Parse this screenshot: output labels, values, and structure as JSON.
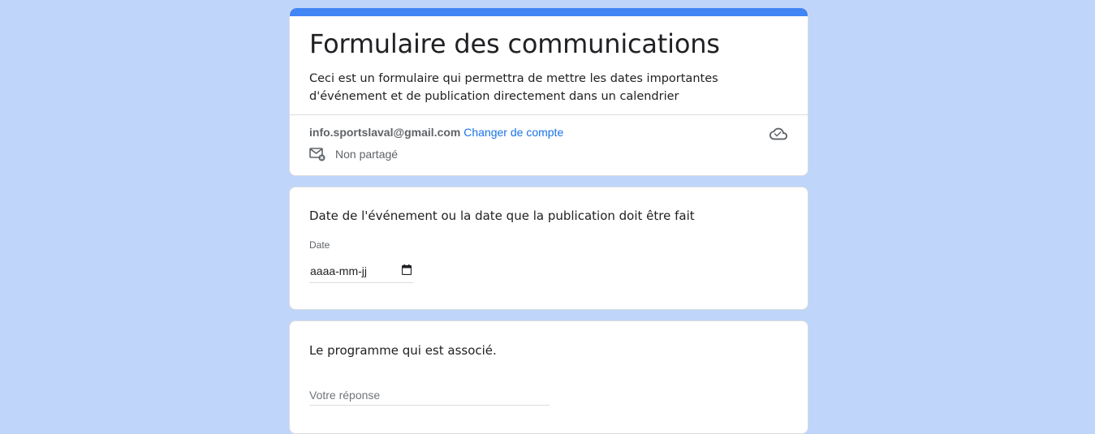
{
  "form": {
    "title": "Formulaire des communications",
    "description": "Ceci est un formulaire qui permettra de mettre les dates importantes d'événement et de publication directement dans un calendrier",
    "account_email": "info.sportslaval@gmail.com",
    "switch_account": "Changer de compte",
    "not_shared": "Non partagé",
    "accent_color": "#4285f4",
    "background_color": "#bfd5fa"
  },
  "questions": [
    {
      "title": "Date de l'événement ou la date que la publication doit être fait",
      "field_label": "Date",
      "value_placeholder": "aaaa-mm-jj"
    },
    {
      "title": "Le programme qui est associé.",
      "placeholder": "Votre réponse"
    }
  ],
  "icons": {
    "cloud": "cloud-check-icon",
    "mail": "mail-not-shared-icon",
    "calendar": "calendar-icon"
  }
}
